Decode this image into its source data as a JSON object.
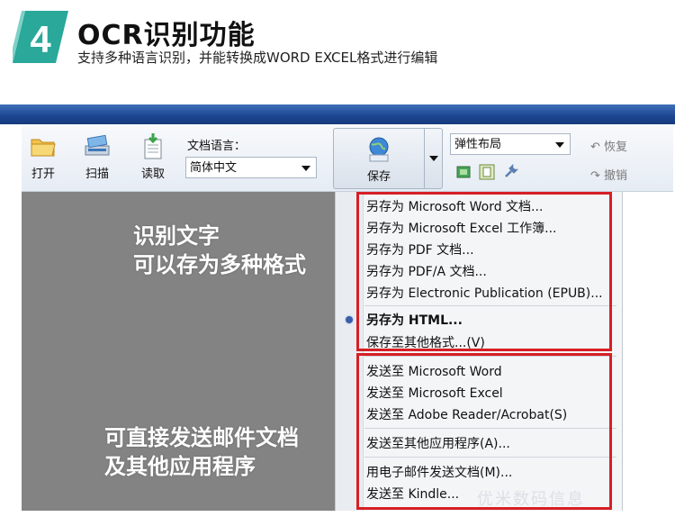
{
  "header": {
    "badge_number": "4",
    "title": "OCR识别功能",
    "subtitle": "支持多种语言识别，并能转换成WORD EXCEL格式进行编辑"
  },
  "toolbar": {
    "open_label": "打开",
    "scan_label": "扫描",
    "read_label": "读取",
    "lang_label": "文档语言：",
    "lang_value": "简体中文",
    "save_label": "保存",
    "layout_value": "弹性布局",
    "undo_label": "恢复",
    "redo_label": "撤销"
  },
  "overlays": {
    "top": [
      "识别文字",
      "可以存为多种格式"
    ],
    "bottom": [
      "可直接发送邮件文档",
      "及其他应用程序"
    ]
  },
  "menu": {
    "items": [
      "另存为 Microsoft Word 文档...",
      "另存为 Microsoft Excel 工作簿...",
      "另存为 PDF 文档...",
      "另存为 PDF/A 文档...",
      "另存为 Electronic Publication (EPUB)...",
      "另存为 HTML...",
      "保存至其他格式...(V)",
      "发送至 Microsoft Word",
      "发送至 Microsoft Excel",
      "发送至 Adobe Reader/Acrobat(S)",
      "发送至其他应用程序(A)...",
      "用电子邮件发送文档(M)...",
      "发送至 Kindle..."
    ]
  },
  "watermark": "优米数码信息",
  "colors": {
    "badge": "#2aa89a",
    "toolbar_bar": "#1c4591",
    "highlight_box": "#d61f25",
    "workspace": "#838383"
  },
  "icons": [
    "open-folder-icon",
    "scan-icon",
    "read-icon",
    "globe-html-icon",
    "chevron-down-icon",
    "image-icon",
    "layout-icon",
    "wrench-icon",
    "undo-icon",
    "redo-icon"
  ]
}
